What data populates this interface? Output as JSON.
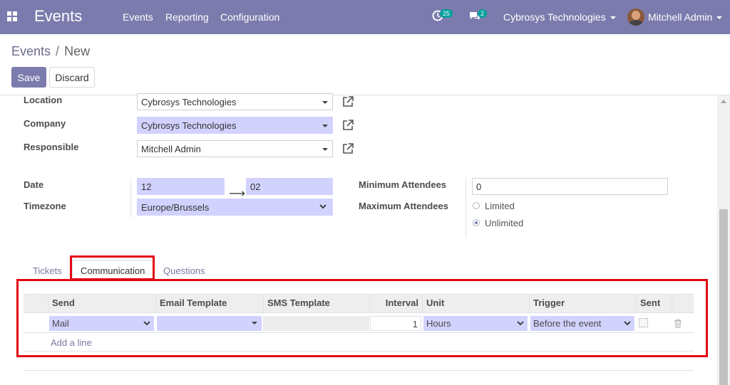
{
  "navbar": {
    "app_name": "Events",
    "menu": [
      "Events",
      "Reporting",
      "Configuration"
    ],
    "activity_count": "25",
    "message_count": "2",
    "company": "Cybrosys Technologies",
    "user": "Mitchell Admin"
  },
  "breadcrumb": {
    "parent": "Events",
    "separator": "/",
    "current": "New"
  },
  "actions": {
    "save": "Save",
    "discard": "Discard"
  },
  "form": {
    "location": {
      "label": "Location",
      "value": "Cybrosys Technologies"
    },
    "company": {
      "label": "Company",
      "value": "Cybrosys Technologies"
    },
    "responsible": {
      "label": "Responsible",
      "value": "Mitchell Admin"
    },
    "date": {
      "label": "Date",
      "start": "12",
      "end": "02"
    },
    "timezone": {
      "label": "Timezone",
      "value": "Europe/Brussels"
    },
    "min_attendees": {
      "label": "Minimum Attendees",
      "value": "0"
    },
    "max_attendees": {
      "label": "Maximum Attendees",
      "options": [
        "Limited",
        "Unlimited"
      ],
      "selected": "Unlimited"
    }
  },
  "tabs": [
    "Tickets",
    "Communication",
    "Questions"
  ],
  "active_tab": "Communication",
  "table": {
    "columns": [
      "Send",
      "Email Template",
      "SMS Template",
      "Interval",
      "Unit",
      "Trigger",
      "Sent"
    ],
    "rows": [
      {
        "send": "Mail",
        "email_template": "",
        "sms_template": "",
        "interval": "1",
        "unit": "Hours",
        "trigger": "Before the event",
        "sent": false
      }
    ],
    "add_line": "Add a line"
  }
}
